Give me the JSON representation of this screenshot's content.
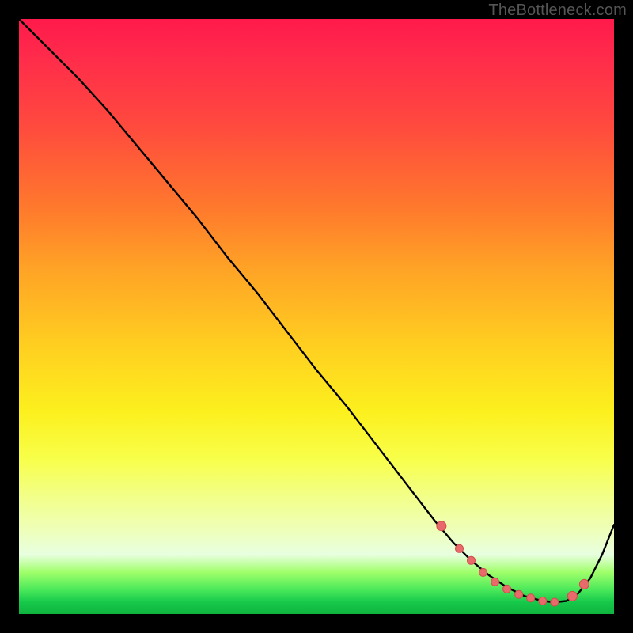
{
  "watermark": "TheBottleneck.com",
  "colors": {
    "curve": "#000000",
    "marker": "#e86a6a",
    "marker_stroke": "#d24e4e"
  },
  "chart_data": {
    "type": "line",
    "title": "",
    "xlabel": "",
    "ylabel": "",
    "xlim": [
      0,
      100
    ],
    "ylim": [
      0,
      100
    ],
    "grid": false,
    "series": [
      {
        "name": "bottleneck-curve",
        "x": [
          0,
          3,
          6,
          10,
          15,
          20,
          25,
          30,
          35,
          40,
          45,
          50,
          55,
          60,
          65,
          70,
          73,
          76,
          79,
          82,
          85,
          88,
          90,
          92,
          94,
          96,
          98,
          100
        ],
        "y": [
          100,
          97,
          94,
          90,
          84.5,
          78.5,
          72.5,
          66.5,
          60,
          54,
          47.5,
          41,
          35,
          28.5,
          22,
          15.5,
          12,
          9,
          6.5,
          4.5,
          3,
          2.2,
          2,
          2.2,
          3.5,
          6,
          10,
          15
        ]
      }
    ],
    "markers": {
      "name": "highlighted-points",
      "x": [
        71,
        74,
        76,
        78,
        80,
        82,
        84,
        86,
        88,
        90,
        93,
        95
      ],
      "y": [
        14.8,
        11,
        9,
        7,
        5.4,
        4.2,
        3.3,
        2.7,
        2.2,
        2,
        3,
        5
      ]
    }
  }
}
